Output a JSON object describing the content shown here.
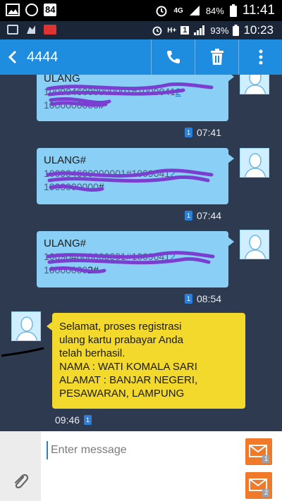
{
  "outer_status": {
    "notif_badge": "84",
    "battery": "84%",
    "network": "4G",
    "time": "11:41"
  },
  "inner_status": {
    "network": "H+",
    "sim": "1",
    "battery": "93%",
    "time": "10:23"
  },
  "app_bar": {
    "title": "4444",
    "back_icon": "back-arrow-icon",
    "call_icon": "phone-icon",
    "delete_icon": "trash-icon",
    "menu_icon": "more-vert-icon",
    "color": "#1e8de0"
  },
  "messages": [
    {
      "direction": "out",
      "line1": "ULANG",
      "line2_end": "2",
      "line3_end": "#",
      "sim": "1",
      "time": "07:41"
    },
    {
      "direction": "out",
      "line1": "ULANG#",
      "line2_end": "2",
      "line3_end": "#",
      "sim": "1",
      "time": "07:44"
    },
    {
      "direction": "out",
      "line1": "ULANG#",
      "line2_end": "2",
      "line3_end": "2#",
      "sim": "1",
      "time": "08:54"
    },
    {
      "direction": "in",
      "lines": [
        "Selamat, proses registrasi",
        "ulang kartu prabayar Anda",
        "telah berhasil.",
        "NAMA : WATI KOMALA SARI",
        "ALAMAT : BANJAR NEGERI,",
        "PESAWARAN, LAMPUNG"
      ],
      "sim": "1",
      "time": "09:46"
    }
  ],
  "composer": {
    "placeholder": "Enter message",
    "send_sim1": "1",
    "send_sim2": "2",
    "send_color": "#f07a2a"
  }
}
